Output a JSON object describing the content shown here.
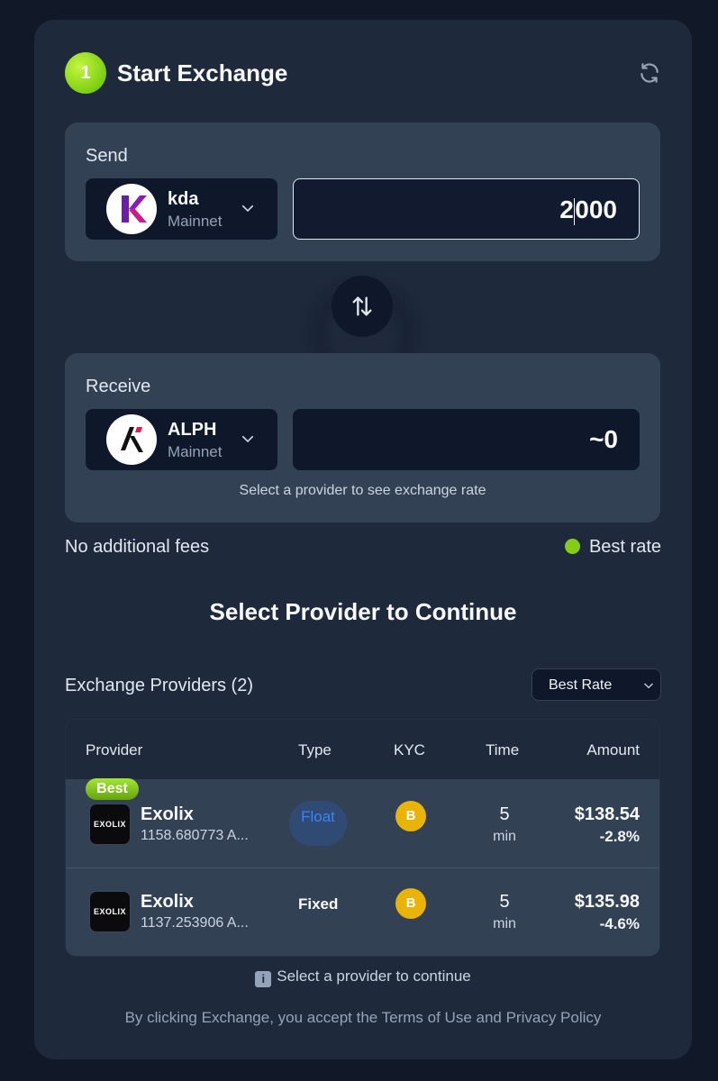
{
  "header": {
    "step": "1",
    "title": "Start Exchange"
  },
  "send": {
    "label": "Send",
    "token": {
      "symbol": "kda",
      "network": "Mainnet",
      "icon": "kadena-logo"
    },
    "amount_before_caret": "2",
    "amount_after_caret": "000"
  },
  "receive": {
    "label": "Receive",
    "token": {
      "symbol": "ALPH",
      "network": "Mainnet",
      "icon": "alephium-logo"
    },
    "amount": "~0",
    "hint": "Select a provider to see exchange rate"
  },
  "fees": {
    "left": "No additional fees",
    "right": "Best rate"
  },
  "section_title": "Select Provider to Continue",
  "providers": {
    "count_label": "Exchange Providers (2)",
    "sort": "Best Rate",
    "columns": [
      "Provider",
      "Type",
      "KYC",
      "Time",
      "Amount"
    ],
    "rows": [
      {
        "badge": "Best",
        "logo_text": "EXOLIX",
        "name": "Exolix",
        "sub": "1158.680773 A...",
        "type": "Float",
        "kyc": "B",
        "time": "5",
        "time_unit": "min",
        "amount": "$138.54",
        "change": "-2.8%"
      },
      {
        "badge": "",
        "logo_text": "EXOLIX",
        "name": "Exolix",
        "sub": "1137.253906 A...",
        "type": "Fixed",
        "kyc": "B",
        "time": "5",
        "time_unit": "min",
        "amount": "$135.98",
        "change": "-4.6%"
      }
    ]
  },
  "footer": {
    "info_glyph": "i",
    "note": "Select a provider to continue",
    "terms": "By clicking Exchange, you accept the Terms of Use and Privacy Policy"
  },
  "colors": {
    "accent_green": "#84cc16",
    "kyc_badge": "#eab308",
    "float_text": "#3b82f6",
    "card": "#1e293b",
    "panel": "#334155"
  }
}
